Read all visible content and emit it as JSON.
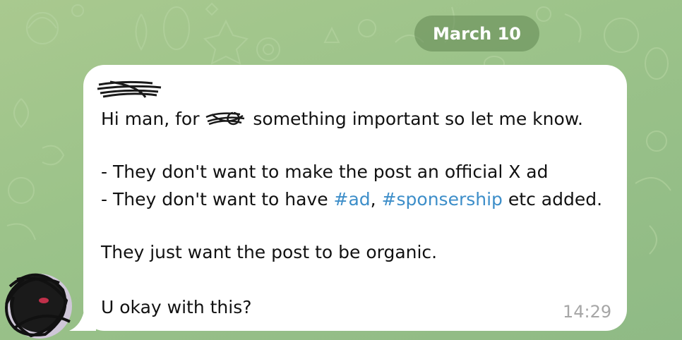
{
  "chat": {
    "date_label": "March 10",
    "message": {
      "sender": "",
      "line_1_before": "Hi man, for ",
      "line_1_after": " something important so let me know.",
      "line_2": "- They don't want to make the post an official X ad",
      "line_3_before": "- They don't want to have ",
      "hashtag_1": "#ad",
      "line_3_sep": ", ",
      "hashtag_2": "#sponsership",
      "line_3_after": " etc added.",
      "line_4": "They just want the post to be organic.",
      "line_5": "U okay with this?",
      "time": "14:29"
    },
    "avatar": "redacted-avatar"
  },
  "colors": {
    "background": "#9cc38a",
    "bubble": "#ffffff",
    "date_pill": "#6f9763",
    "hashtag": "#3d8ec9",
    "timestamp": "#a6a6a6"
  },
  "icons": [
    "doodle-pattern",
    "scribble-redaction"
  ]
}
